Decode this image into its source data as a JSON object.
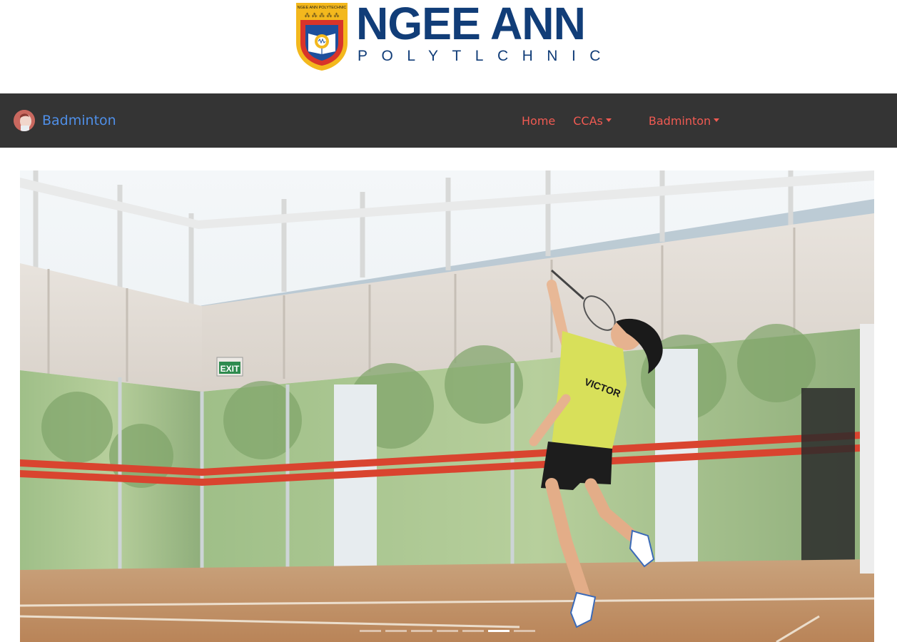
{
  "logo": {
    "name": "NGEE ANN",
    "subtitle": "POLYTLCHNIC",
    "crest_text": "NGEE ANN POLYTECHNIC"
  },
  "navbar": {
    "brand_label": "Badminton",
    "links": [
      {
        "label": "Home",
        "dropdown": false
      },
      {
        "label": "CCAs",
        "dropdown": true
      },
      {
        "label": "Badminton",
        "dropdown": true
      }
    ]
  },
  "carousel": {
    "slide_count": 7,
    "active_index": 5,
    "exit_sign_text": "EXIT",
    "shirt_text": "VICTOR"
  },
  "colors": {
    "navbar_bg": "#343434",
    "brand": "#4f8fe8",
    "nav_link": "#f05a52",
    "logo_navy": "#113d78"
  }
}
